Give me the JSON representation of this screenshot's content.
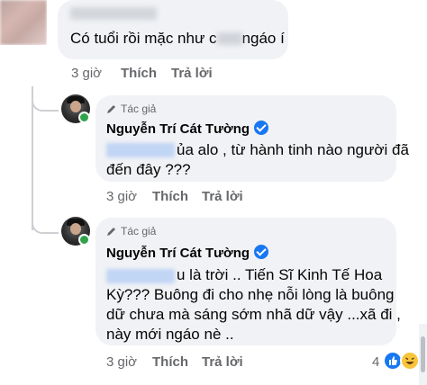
{
  "comment1": {
    "text_before": "Có tuổi rồi mặc như c",
    "text_after": "ngáo í",
    "time": "3 giờ",
    "like": "Thích",
    "reply": "Trả lời"
  },
  "reply1": {
    "author_tag": "Tác giả",
    "author_name": "Nguyễn Trí Cát Tường",
    "line1": "ủa alo , từ hành tinh nào người đã",
    "line2": "đến đây ???",
    "time": "3 giờ",
    "like": "Thích",
    "reply": "Trả lời"
  },
  "reply2": {
    "author_tag": "Tác giả",
    "author_name": "Nguyễn Trí Cát Tường",
    "line1": "u là trời .. Tiến Sĩ Kinh Tế Hoa",
    "line2": "Kỳ??? Buông đi cho nhẹ nỗi lòng là buông",
    "line3": "dữ chưa mà sáng sớm nhã dữ vậy ...xã đi ,",
    "line4": "này mới ngáo nè ..",
    "time": "3 giờ",
    "like": "Thích",
    "reply": "Trả lời",
    "reaction_count": "4"
  },
  "icons": {
    "author_tag_icon": "pen-icon",
    "verified": "verified-badge-icon",
    "reactions": [
      "like-icon",
      "haha-icon"
    ]
  },
  "colors": {
    "bubble": "#f0f2f5",
    "meta": "#65676b",
    "verified": "#1877f2",
    "mention": "#bcd2f5",
    "online": "#31a24c"
  }
}
